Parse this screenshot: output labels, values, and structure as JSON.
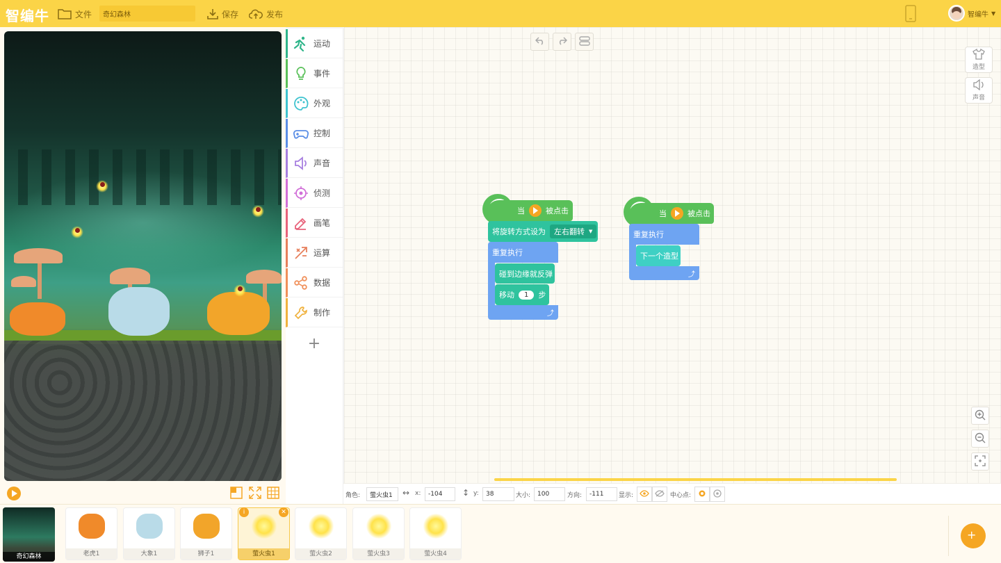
{
  "app": {
    "logo": "智编牛",
    "user_name": "智编牛"
  },
  "toolbar": {
    "file_label": "文件",
    "project_name": "奇幻森林",
    "save_label": "保存",
    "publish_label": "发布"
  },
  "categories": [
    {
      "label": "运动",
      "color": "#2fb58a",
      "icon": "running-icon"
    },
    {
      "label": "事件",
      "color": "#59c059",
      "icon": "bulb-icon"
    },
    {
      "label": "外观",
      "color": "#3ec3cf",
      "icon": "palette-icon"
    },
    {
      "label": "控制",
      "color": "#5b8ee6",
      "icon": "gamepad-icon"
    },
    {
      "label": "声音",
      "color": "#a77fe0",
      "icon": "speaker-icon"
    },
    {
      "label": "侦测",
      "color": "#d16fd8",
      "icon": "target-icon"
    },
    {
      "label": "画笔",
      "color": "#e8637b",
      "icon": "pen-icon"
    },
    {
      "label": "运算",
      "color": "#e77f5b",
      "icon": "math-icon"
    },
    {
      "label": "数据",
      "color": "#f0905a",
      "icon": "share-icon"
    },
    {
      "label": "制作",
      "color": "#f0b23e",
      "icon": "wrench-icon"
    }
  ],
  "side_panel": {
    "costume_label": "造型",
    "sound_label": "声音"
  },
  "scripts": {
    "s1": {
      "hat_when": "当",
      "hat_clicked": "被点击",
      "rotation_label": "将旋转方式设为",
      "rotation_value": "左右翻转",
      "forever_label": "重复执行",
      "bounce_label": "碰到边缘就反弹",
      "move_label": "移动",
      "move_value": "1",
      "move_unit": "步"
    },
    "s2": {
      "hat_when": "当",
      "hat_clicked": "被点击",
      "forever_label": "重复执行",
      "next_costume_label": "下一个造型"
    }
  },
  "props": {
    "role_label": "角色:",
    "role_value": "萤火虫1",
    "x_label": "x:",
    "x_value": "-104",
    "y_label": "y:",
    "y_value": "38",
    "size_label": "大小:",
    "size_value": "100",
    "dir_label": "方向:",
    "dir_value": "-111",
    "show_label": "显示:",
    "center_label": "中心点:"
  },
  "backdrop": {
    "label": "奇幻森林"
  },
  "sprites": [
    {
      "label": "老虎1",
      "kind": "tiger",
      "color": "#f08a2a"
    },
    {
      "label": "大象1",
      "kind": "elephant",
      "color": "#b9dbe8"
    },
    {
      "label": "狮子1",
      "kind": "lion",
      "color": "#f2a52a"
    },
    {
      "label": "萤火虫1",
      "kind": "firefly",
      "color": "#ffe24a",
      "selected": true
    },
    {
      "label": "萤火虫2",
      "kind": "firefly",
      "color": "#ffe24a"
    },
    {
      "label": "萤火虫3",
      "kind": "firefly",
      "color": "#ffe24a"
    },
    {
      "label": "萤火虫4",
      "kind": "firefly",
      "color": "#ffe24a"
    }
  ],
  "colors": {
    "accent": "#fbd447",
    "event_green": "#59c059",
    "motion_teal": "#2fc39e",
    "control_blue": "#6ea4f2",
    "orange": "#f5a623"
  }
}
